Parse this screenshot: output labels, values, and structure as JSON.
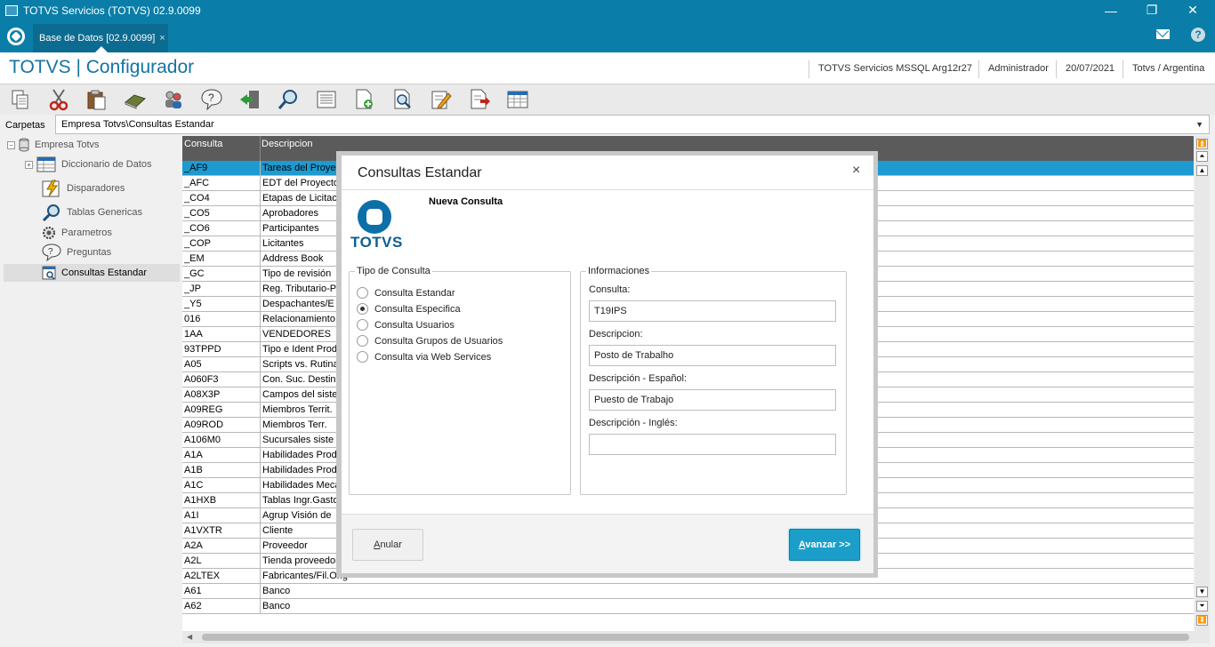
{
  "window": {
    "title": "TOTVS Servicios (TOTVS) 02.9.0099",
    "minimize": "—",
    "maximize": "❐",
    "close": "✕"
  },
  "tabs": [
    {
      "label": "Base de Datos [02.9.0099]",
      "close": "×"
    }
  ],
  "header": {
    "app_title": "TOTVS | Configurador",
    "server": "TOTVS Servicios MSSQL Arg12r27",
    "user": "Administrador",
    "date": "20/07/2021",
    "company": "Totvs / Argentina",
    "help": "?"
  },
  "toolbar": {
    "icons": [
      "copy-icon",
      "cut-icon",
      "paste-icon",
      "book-icon",
      "users-icon",
      "help-icon",
      "exit-icon",
      "search-icon",
      "list-icon",
      "add-doc-icon",
      "preview-icon",
      "edit-icon",
      "export-icon",
      "table-icon"
    ]
  },
  "carpetas": {
    "label": "Carpetas",
    "value": "Empresa Totvs\\Consultas Estandar"
  },
  "tree": {
    "items": [
      {
        "label": "Empresa Totvs",
        "icon": "database-icon"
      },
      {
        "label": "Diccionario de Datos",
        "icon": "table-icon"
      },
      {
        "label": "Disparadores",
        "icon": "trigger-icon"
      },
      {
        "label": "Tablas Genericas",
        "icon": "search-icon"
      },
      {
        "label": "Parametros",
        "icon": "settings-icon"
      },
      {
        "label": "Preguntas",
        "icon": "question-icon"
      },
      {
        "label": "Consultas Estandar",
        "icon": "query-icon"
      }
    ]
  },
  "grid": {
    "columns": [
      "Consulta",
      "Descripcion"
    ],
    "rows": [
      [
        "_AF9",
        "Tareas del Proyecto"
      ],
      [
        "_AFC",
        "EDT del Proyecto"
      ],
      [
        "_CO4",
        "Etapas de Licitacion"
      ],
      [
        "_CO5",
        "Aprobadores"
      ],
      [
        "_CO6",
        "Participantes"
      ],
      [
        "_COP",
        "Licitantes"
      ],
      [
        "_EM",
        "Address Book"
      ],
      [
        "_GC",
        "Tipo de revisión"
      ],
      [
        "_JP",
        "Reg. Tributario-P"
      ],
      [
        "_Y5",
        "Despachantes/E"
      ],
      [
        "016",
        "Relacionamiento"
      ],
      [
        "1AA",
        "VENDEDORES"
      ],
      [
        "93TPPD",
        "Tipo e Ident Produ"
      ],
      [
        "A05",
        "Scripts vs. Rutina"
      ],
      [
        "A060F3",
        "Con. Suc. Destino"
      ],
      [
        "A08X3P",
        "Campos del siste"
      ],
      [
        "A09REG",
        "Miembros Territ."
      ],
      [
        "A09ROD",
        "Miembros Terr."
      ],
      [
        "A106M0",
        "Sucursales siste"
      ],
      [
        "A1A",
        "Habilidades Produ"
      ],
      [
        "A1B",
        "Habilidades Produ"
      ],
      [
        "A1C",
        "Habilidades Meca"
      ],
      [
        "A1HXB",
        "Tablas Ingr.Gasto"
      ],
      [
        "A1I",
        "Agrup Visión de"
      ],
      [
        "A1VXTR",
        "Cliente"
      ],
      [
        "A2A",
        "Proveedor"
      ],
      [
        "A2L",
        "Tienda proveedor"
      ],
      [
        "A2LTEX",
        "Fabricantes/Fil.Orig"
      ],
      [
        "A61",
        "Banco"
      ],
      [
        "A62",
        "Banco"
      ]
    ]
  },
  "modal": {
    "title": "Consultas Estandar",
    "close": "×",
    "subtitle": "Nueva Consulta",
    "brand_text": "TOTVS",
    "tipo": {
      "legend": "Tipo de Consulta",
      "options": [
        {
          "label": "Consulta Estandar",
          "selected": false
        },
        {
          "label": "Consulta Especifica",
          "selected": true
        },
        {
          "label": "Consulta Usuarios",
          "selected": false
        },
        {
          "label": "Consulta Grupos de Usuarios",
          "selected": false
        },
        {
          "label": "Consulta via Web Services",
          "selected": false
        }
      ]
    },
    "info": {
      "legend": "Informaciones",
      "fields": [
        {
          "label": "Consulta:",
          "value": "T19IPS"
        },
        {
          "label": "Descripcion:",
          "value": "Posto de Trabalho"
        },
        {
          "label": "Descripción - Español:",
          "value": "Puesto de Trabajo"
        },
        {
          "label": "Descripción - Inglés:",
          "value": ""
        }
      ]
    },
    "buttons": {
      "anular": "Anular",
      "avanzar": "Avanzar >>"
    }
  },
  "colors": {
    "accent": "#0a7ea8",
    "selected_row": "#1d9bd1",
    "primary_button": "#1b9ec9"
  }
}
